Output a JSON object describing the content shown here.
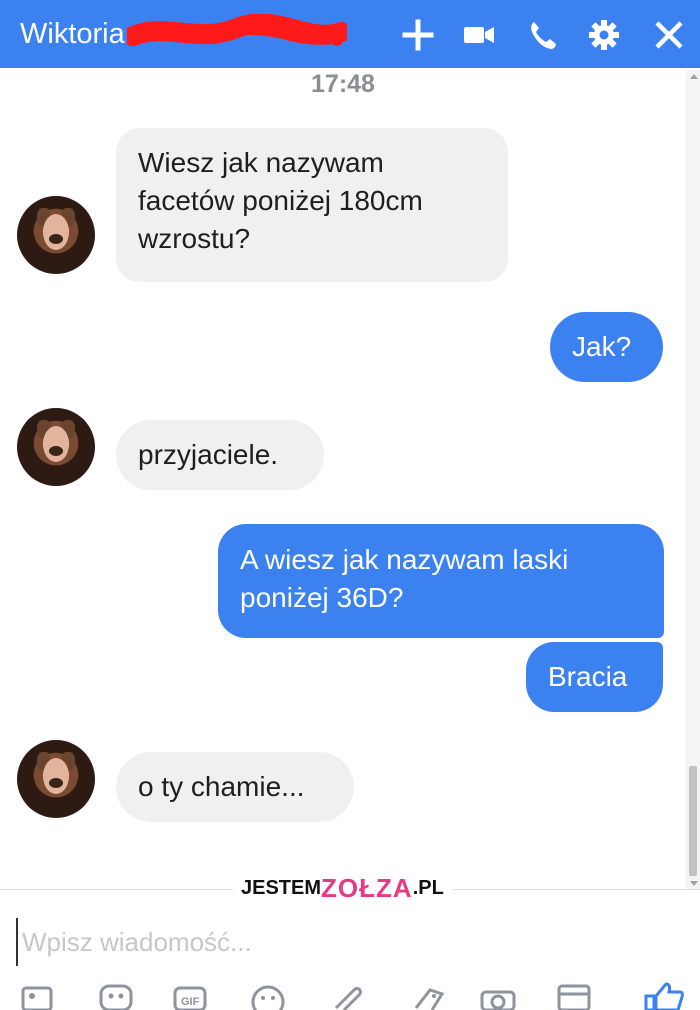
{
  "header": {
    "contact_name": "Wiktoria",
    "icons": [
      "plus-icon",
      "video-camera-icon",
      "phone-icon",
      "gear-icon",
      "close-icon"
    ],
    "accent": "#3b82f0"
  },
  "chat": {
    "timestamp": "17:48",
    "messages": [
      {
        "from": "them",
        "text": "Wiesz jak nazywam\nfacetów poniżej 180cm\nwzrostu?"
      },
      {
        "from": "me",
        "text": "Jak?"
      },
      {
        "from": "them",
        "text": "przyjaciele."
      },
      {
        "from": "me",
        "text": "A wiesz jak nazywam laski\nponiżej 36D?"
      },
      {
        "from": "me",
        "text": "Bracia"
      },
      {
        "from": "them",
        "text": "o ty chamie..."
      }
    ]
  },
  "watermark": {
    "prefix": "JESTEM",
    "middle": "ZOŁZA",
    "suffix": ".PL"
  },
  "composer": {
    "placeholder": "Wpisz wiadomość...",
    "tools": [
      "photo-icon",
      "sticker-icon",
      "gif-icon",
      "emoji-icon",
      "attachment-icon",
      "payment-icon",
      "camera-icon",
      "game-icon",
      "like-icon"
    ]
  }
}
